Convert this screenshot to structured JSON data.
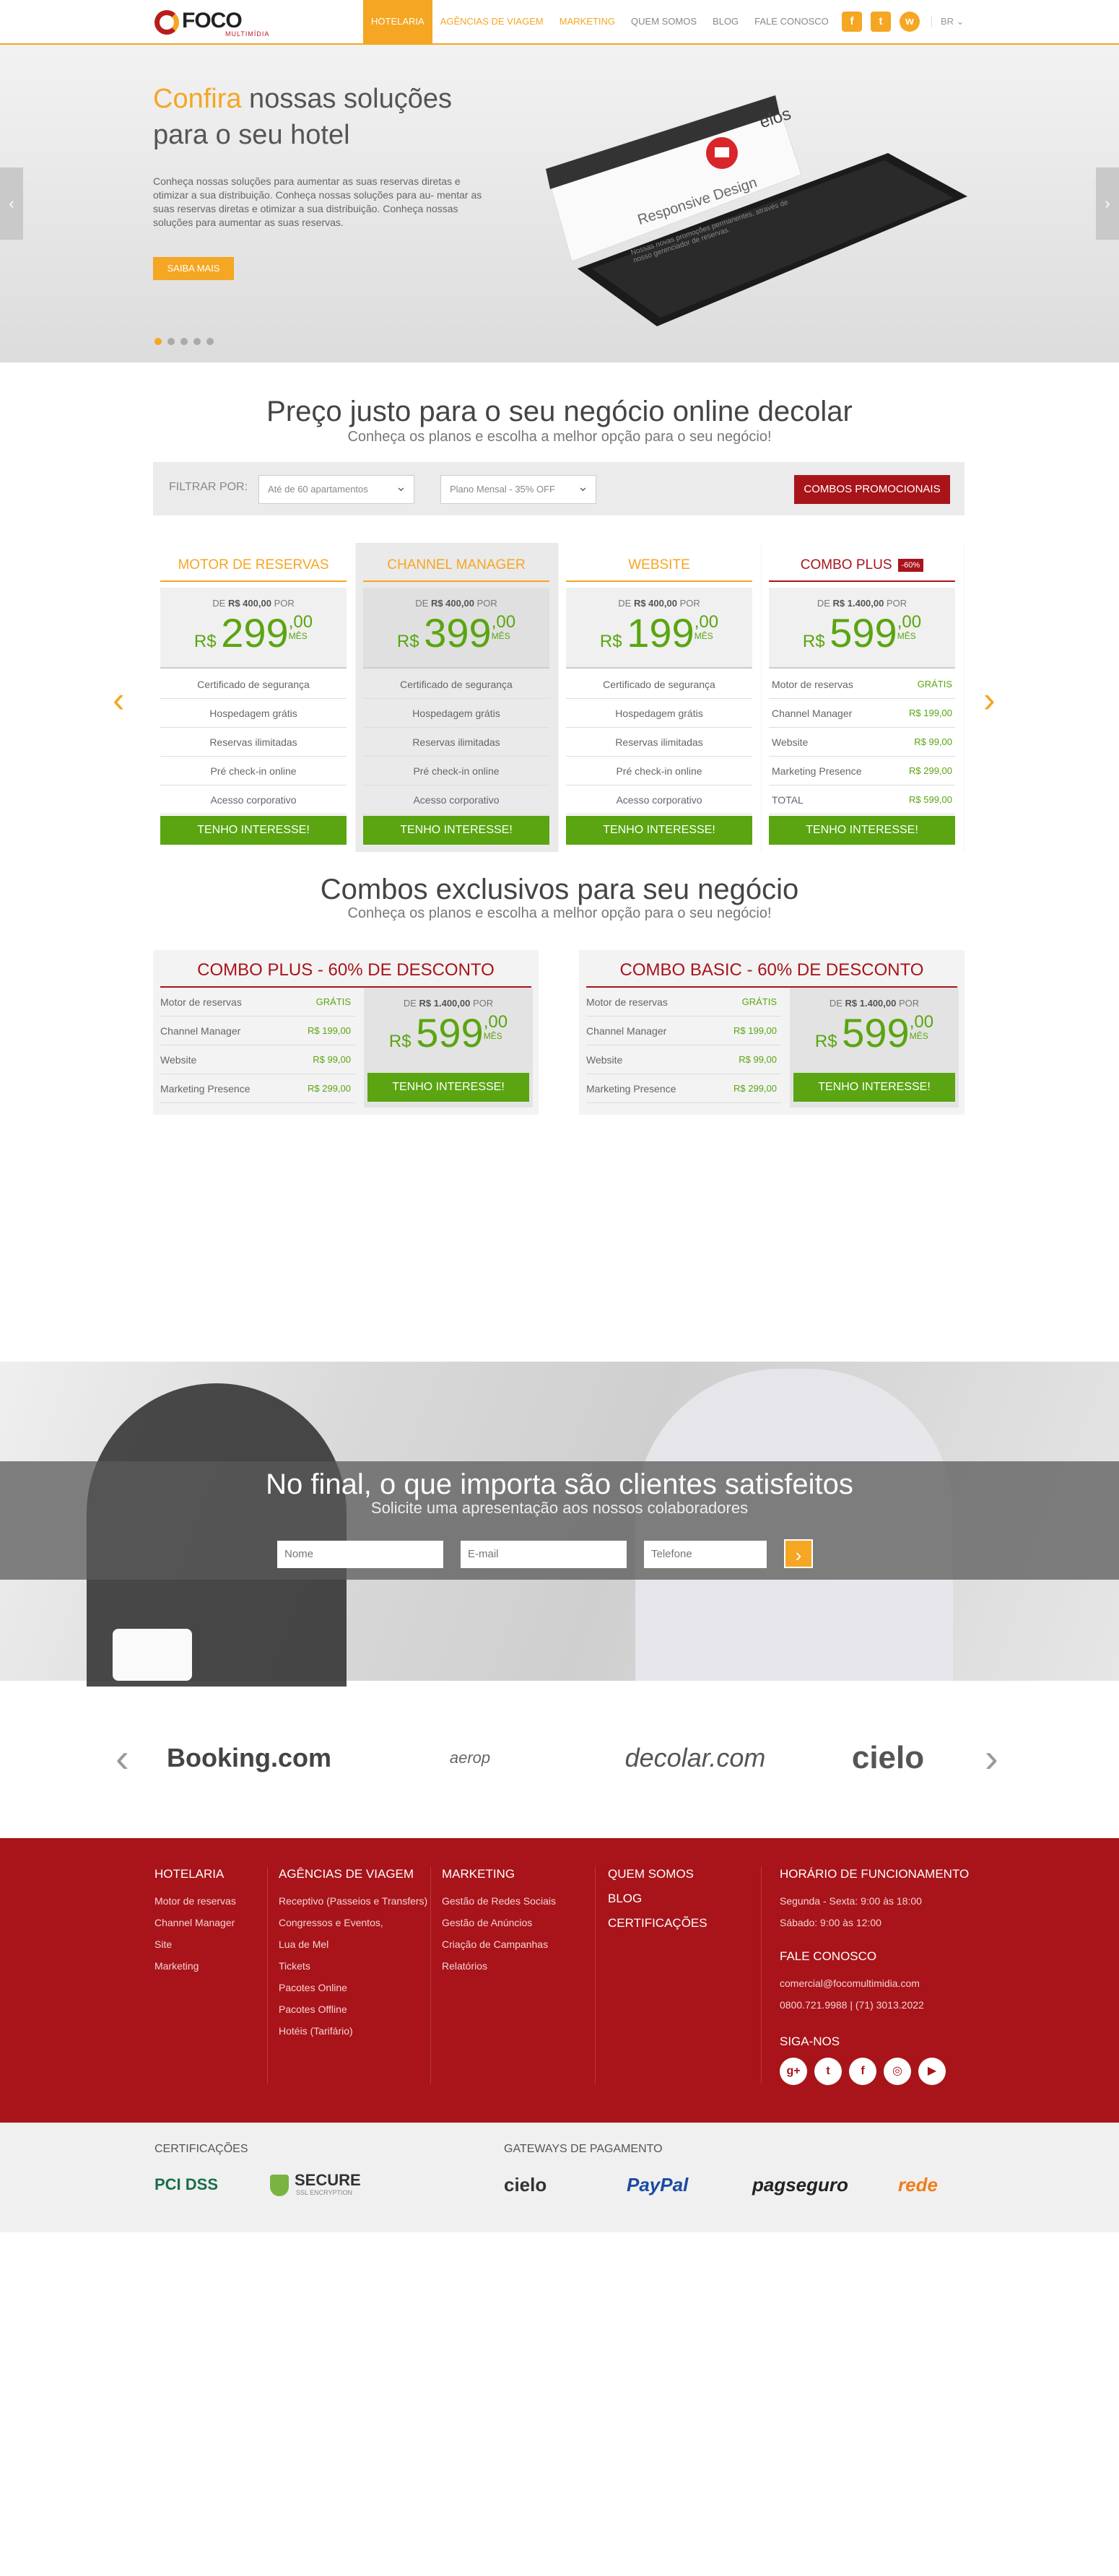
{
  "header": {
    "logo_text": "FOCO",
    "logo_sub": "MULTIMÍDIA",
    "nav": [
      "HOTELARIA",
      "AGÊNCIAS DE VIAGEM",
      "MARKETING",
      "QUEM SOMOS",
      "BLOG",
      "FALE CONOSCO"
    ],
    "social": [
      "f",
      "t",
      "w"
    ],
    "lang": "BR ⌄"
  },
  "hero": {
    "title_highlight": "Confira",
    "title_rest": " nossas soluções para o seu hotel",
    "text": "Conheça nossas soluções para aumentar as suas reservas diretas e otimizar a sua distribuição. Conheça nossas soluções para au- mentar as suas reservas diretas e otimizar a sua distribuição. Conheça nossas soluções para aumentar as suas reservas.",
    "button": "SAIBA MAIS",
    "prev": "‹",
    "next": "›",
    "tablet_brand": "elos",
    "tablet_heading": "Responsive Design",
    "tablet_text": "Nossas novas promoções permanentes, através de nosso gerenciador de reservas."
  },
  "pricing": {
    "title": "Preço justo para o seu negócio online decolar",
    "subtitle": "Conheça os planos e escolha a melhor opção para o seu negócio!",
    "filter_label": "FILTRAR POR:",
    "select1": "Até de 60 apartamentos",
    "select2": "Plano Mensal - 35% OFF",
    "combos_button": "COMBOS PROMOCIONAIS",
    "plans": [
      {
        "name": "MOTOR DE RESERVAS",
        "de": "DE",
        "old": "R$ 400,00",
        "por": "POR",
        "currency": "R$",
        "int": "299",
        "cents": ",00",
        "mes": "MÊS",
        "features": [
          "Certificado de segurança",
          "Hospedagem grátis",
          "Reservas ilimitadas",
          "Pré check-in online",
          "Acesso corporativo"
        ],
        "button": "TENHO INTERESSE!"
      },
      {
        "name": "CHANNEL MANAGER",
        "de": "DE",
        "old": "R$ 400,00",
        "por": "POR",
        "currency": "R$",
        "int": "399",
        "cents": ",00",
        "mes": "MÊS",
        "features": [
          "Certificado de segurança",
          "Hospedagem grátis",
          "Reservas ilimitadas",
          "Pré check-in online",
          "Acesso corporativo"
        ],
        "button": "TENHO INTERESSE!"
      },
      {
        "name": "WEBSITE",
        "de": "DE",
        "old": "R$ 400,00",
        "por": "POR",
        "currency": "R$",
        "int": "199",
        "cents": ",00",
        "mes": "MÊS",
        "features": [
          "Certificado de segurança",
          "Hospedagem grátis",
          "Reservas ilimitadas",
          "Pré check-in online",
          "Acesso corporativo"
        ],
        "button": "TENHO INTERESSE!"
      },
      {
        "name": "COMBO PLUS",
        "badge": "-60%",
        "de": "DE",
        "old": "R$ 1.400,00",
        "por": "POR",
        "currency": "R$",
        "int": "599",
        "cents": ",00",
        "mes": "MÊS",
        "rows": [
          [
            "Motor de reservas",
            "GRÁTIS"
          ],
          [
            "Channel Manager",
            "R$ 199,00"
          ],
          [
            "Website",
            "R$ 99,00"
          ],
          [
            "Marketing Presence",
            "R$ 299,00"
          ],
          [
            "TOTAL",
            "R$ 599,00"
          ]
        ],
        "button": "TENHO INTERESSE!"
      }
    ],
    "prev": "‹",
    "next": "›"
  },
  "combos": {
    "title": "Combos exclusivos para seu negócio",
    "subtitle": "Conheça os planos e escolha a melhor opção para o seu negócio!",
    "items": [
      {
        "title": "COMBO PLUS - 60% DE DESCONTO",
        "rows": [
          [
            "Motor de reservas",
            "GRÁTIS"
          ],
          [
            "Channel Manager",
            "R$ 199,00"
          ],
          [
            "Website",
            "R$ 99,00"
          ],
          [
            "Marketing Presence",
            "R$ 299,00"
          ]
        ],
        "de": "DE",
        "old": "R$ 1.400,00",
        "por": "POR",
        "currency": "R$",
        "int": "599",
        "cents": ",00",
        "mes": "MÊS",
        "button": "TENHO INTERESSE!"
      },
      {
        "title": "COMBO BASIC - 60% DE DESCONTO",
        "rows": [
          [
            "Motor de reservas",
            "GRÁTIS"
          ],
          [
            "Channel Manager",
            "R$ 199,00"
          ],
          [
            "Website",
            "R$ 99,00"
          ],
          [
            "Marketing Presence",
            "R$ 299,00"
          ]
        ],
        "de": "DE",
        "old": "R$ 1.400,00",
        "por": "POR",
        "currency": "R$",
        "int": "599",
        "cents": ",00",
        "mes": "MÊS",
        "button": "TENHO INTERESSE!"
      }
    ]
  },
  "contact": {
    "title": "No final, o que importa são clientes satisfeitos",
    "subtitle": "Solicite uma apresentação aos nossos colaboradores",
    "name_placeholder": "Nome",
    "email_placeholder": "E-mail",
    "phone_placeholder": "Telefone",
    "send": "›"
  },
  "partners": {
    "logos": [
      "Booking.com",
      "aerop",
      "decolar.com",
      "cielo"
    ],
    "prev": "‹",
    "next": "›"
  },
  "footer": {
    "col1": {
      "title": "HOTELARIA",
      "links": [
        "Motor de reservas",
        "Channel Manager",
        "Site",
        "Marketing"
      ]
    },
    "col2": {
      "title": "AGÊNCIAS DE VIAGEM",
      "links": [
        "Receptivo (Passeios e Transfers)",
        "Congressos e Eventos,",
        "Lua de Mel",
        "Tickets",
        "Pacotes Online",
        "Pacotes Offline",
        "Hotéis (Tarifário)"
      ]
    },
    "col3": {
      "title": "MARKETING",
      "links": [
        "Gestão de Redes Sociais",
        "Gestão de Anúncios",
        "Criação de Campanhas",
        "Relatórios"
      ]
    },
    "col4": {
      "links": [
        "QUEM SOMOS",
        "BLOG",
        "CERTIFICAÇÕES"
      ]
    },
    "col5": {
      "title": "HORÁRIO DE FUNCIONAMENTO",
      "hours1": "Segunda - Sexta: 9:00 às 18:00",
      "hours2": "Sábado: 9:00 às 12:00",
      "contact_title": "FALE CONOSCO",
      "email": "comercial@focomultimidia.com",
      "phone": "0800.721.9988 | (71) 3013.2022",
      "social_title": "SIGA-NOS",
      "social": [
        "g+",
        "t",
        "f",
        "◎",
        "▶"
      ]
    }
  },
  "subfooter": {
    "cert_title": "CERTIFICAÇÕES",
    "cert1": "PCI DSS",
    "cert2": "SECURE",
    "cert2_sub": "SSL ENCRYPTION",
    "pay_title": "GATEWAYS DE PAGAMENTO",
    "pay": [
      "cielo",
      "PayPal",
      "pagseguro",
      "rede"
    ]
  }
}
